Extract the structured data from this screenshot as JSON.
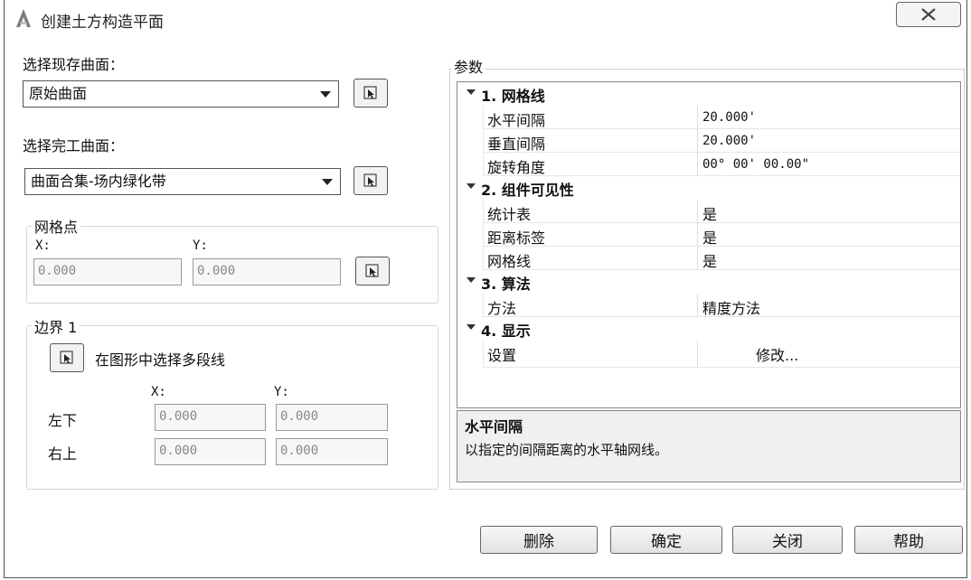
{
  "window": {
    "title": "创建土方构造平面",
    "app_icon": "autocad-icon",
    "close_icon": "close-icon"
  },
  "existing_surface": {
    "label": "选择现存曲面：",
    "value": "原始曲面"
  },
  "finished_surface": {
    "label": "选择完工曲面：",
    "value": "曲面合集-场内绿化带"
  },
  "grid_point": {
    "title": "网格点",
    "x_label": "X:",
    "y_label": "Y:",
    "x_value": "0.000",
    "y_value": "0.000"
  },
  "boundary": {
    "title": "边界 1",
    "pick_label": "在图形中选择多段线",
    "x_label": "X:",
    "y_label": "Y:",
    "lower_left_label": "左下",
    "upper_right_label": "右上",
    "ll_x": "0.000",
    "ll_y": "0.000",
    "ur_x": "0.000",
    "ur_y": "0.000"
  },
  "params": {
    "title": "参数",
    "categories": [
      {
        "label": "1. 网格线",
        "rows": [
          {
            "key": "水平间隔",
            "value": "20.000'"
          },
          {
            "key": "垂直间隔",
            "value": "20.000'"
          },
          {
            "key": "旋转角度",
            "value": "00° 00' 00.00\""
          }
        ]
      },
      {
        "label": "2. 组件可见性",
        "rows": [
          {
            "key": "统计表",
            "value": "是"
          },
          {
            "key": "距离标签",
            "value": "是"
          },
          {
            "key": "网格线",
            "value": "是"
          }
        ]
      },
      {
        "label": "3. 算法",
        "rows": [
          {
            "key": "方法",
            "value": "精度方法"
          }
        ]
      },
      {
        "label": "4. 显示",
        "rows": [
          {
            "key": "设置",
            "value": "修改..."
          }
        ]
      }
    ]
  },
  "description": {
    "title": "水平间隔",
    "text": "以指定的间隔距离的水平轴网线。"
  },
  "buttons": {
    "delete": "删除",
    "ok": "确定",
    "close": "关闭",
    "help": "帮助"
  }
}
